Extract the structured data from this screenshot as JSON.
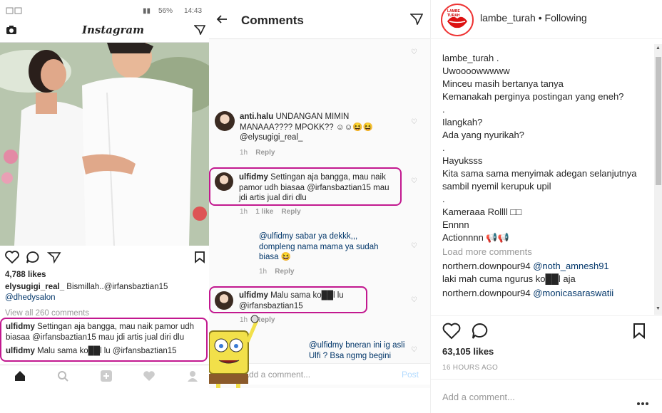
{
  "phone1": {
    "status": {
      "carrier": "",
      "battery": "56%",
      "time": "14:43"
    },
    "header": {
      "logo": "Instagram"
    },
    "likes": "4,788 likes",
    "caption": {
      "user": "elysugigi_real_",
      "text": " Bismillah..@irfansbaztian15",
      "tag": "@dhedysalon"
    },
    "view_all": "View all 260 comments",
    "highlighted": [
      {
        "user": "ulfidmy",
        "text": " Settingan aja bangga, mau naik pamor udh biasaa @irfansbaztian15 mau jdi artis jual diri dlu"
      },
      {
        "user": "ulfidmy",
        "text": " Malu sama ko██l lu @irfansbaztian15"
      }
    ]
  },
  "phone2": {
    "title": "Comments",
    "comments": [
      {
        "user": "anti.halu",
        "text": " UNDANGAN MIMIN MANAAA???? MPOKK?? ☺☺😆😆 @elysugigi_real_",
        "time": "1h",
        "reply": "Reply"
      },
      {
        "user": "ulfidmy",
        "text": " Settingan aja bangga, mau naik pamor udh biasaa @irfansbaztian15 mau jdi artis jual diri dlu",
        "time": "1h",
        "likes": "1 like",
        "reply": "Reply"
      },
      {
        "user": "",
        "text": "@ulfidmy sabar ya dekkk,,, dompleng nama mama ya sudah biasa 😆",
        "time": "1h",
        "reply": "Reply"
      },
      {
        "user": "ulfidmy",
        "text": " Malu sama ko██l lu @irfansbaztian15",
        "time": "1h",
        "reply": "Reply"
      },
      {
        "user": "",
        "text": "@ulfidmy bneran ini ig asli Ulfi ? Bsa ngmg begini",
        "time": "",
        "reply": ""
      }
    ],
    "add_comment_placeholder": "Add a comment...",
    "post_label": "Post"
  },
  "panel": {
    "username": "lambe_turah",
    "follow_sep": "•",
    "following": "Following",
    "avatar_label": "LAMBE TURAH",
    "caption_user": "lambe_turah",
    "caption_lines": [
      "Uwoooowwwww",
      "Minceu masih bertanya tanya",
      "Kemanakah perginya postingan yang eneh?",
      ".",
      "Ilangkah?",
      "Ada yang nyurikah?",
      ".",
      "Hayuksss",
      "Kita sama sama menyimak adegan selanjutnya sambil nyemil kerupuk upil",
      ".",
      "Kameraaa Rollll □□",
      "Ennnn",
      "Actionnnn 📢📢"
    ],
    "load_more": "Load more comments",
    "comments": [
      {
        "user": "northern.downpour94",
        "mention": "@noth_amnesh91",
        "text": "laki mah cuma ngurus ko██l aja"
      },
      {
        "user": "northern.downpour94",
        "mention": "@monicasaraswatii",
        "text": ""
      }
    ],
    "likes": "63,105 likes",
    "time_ago": "16 HOURS AGO",
    "add_comment_placeholder": "Add a comment..."
  },
  "colors": {
    "highlight": "#c2188f",
    "link": "#003569",
    "muted": "#999999"
  }
}
